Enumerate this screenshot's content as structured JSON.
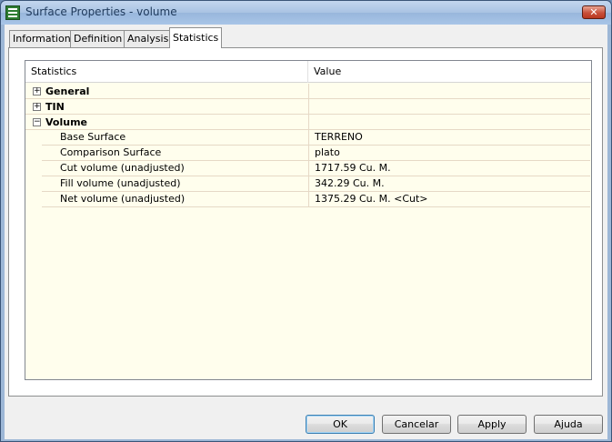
{
  "window": {
    "title": "Surface Properties - volume",
    "close_label": "✕",
    "app_icon": "surface-app-icon"
  },
  "tabs": [
    {
      "label": "Information"
    },
    {
      "label": "Definition"
    },
    {
      "label": "Analysis"
    },
    {
      "label": "Statistics",
      "active": true
    }
  ],
  "grid": {
    "headers": {
      "statistics": "Statistics",
      "value": "Value"
    },
    "groups": {
      "general": {
        "label": "General",
        "toggle": "+"
      },
      "tin": {
        "label": "TIN",
        "toggle": "+"
      },
      "volume": {
        "label": "Volume",
        "toggle": "−"
      }
    },
    "rows": [
      {
        "name": "Base Surface",
        "value": "TERRENO"
      },
      {
        "name": "Comparison Surface",
        "value": "plato"
      },
      {
        "name": "Cut volume (unadjusted)",
        "value": "1717.59 Cu. M."
      },
      {
        "name": "Fill volume (unadjusted)",
        "value": "342.29 Cu. M."
      },
      {
        "name": "Net volume (unadjusted)",
        "value": "1375.29 Cu. M. <Cut>"
      }
    ]
  },
  "buttons": {
    "ok": "OK",
    "cancel": "Cancelar",
    "apply": "Apply",
    "help": "Ajuda"
  }
}
